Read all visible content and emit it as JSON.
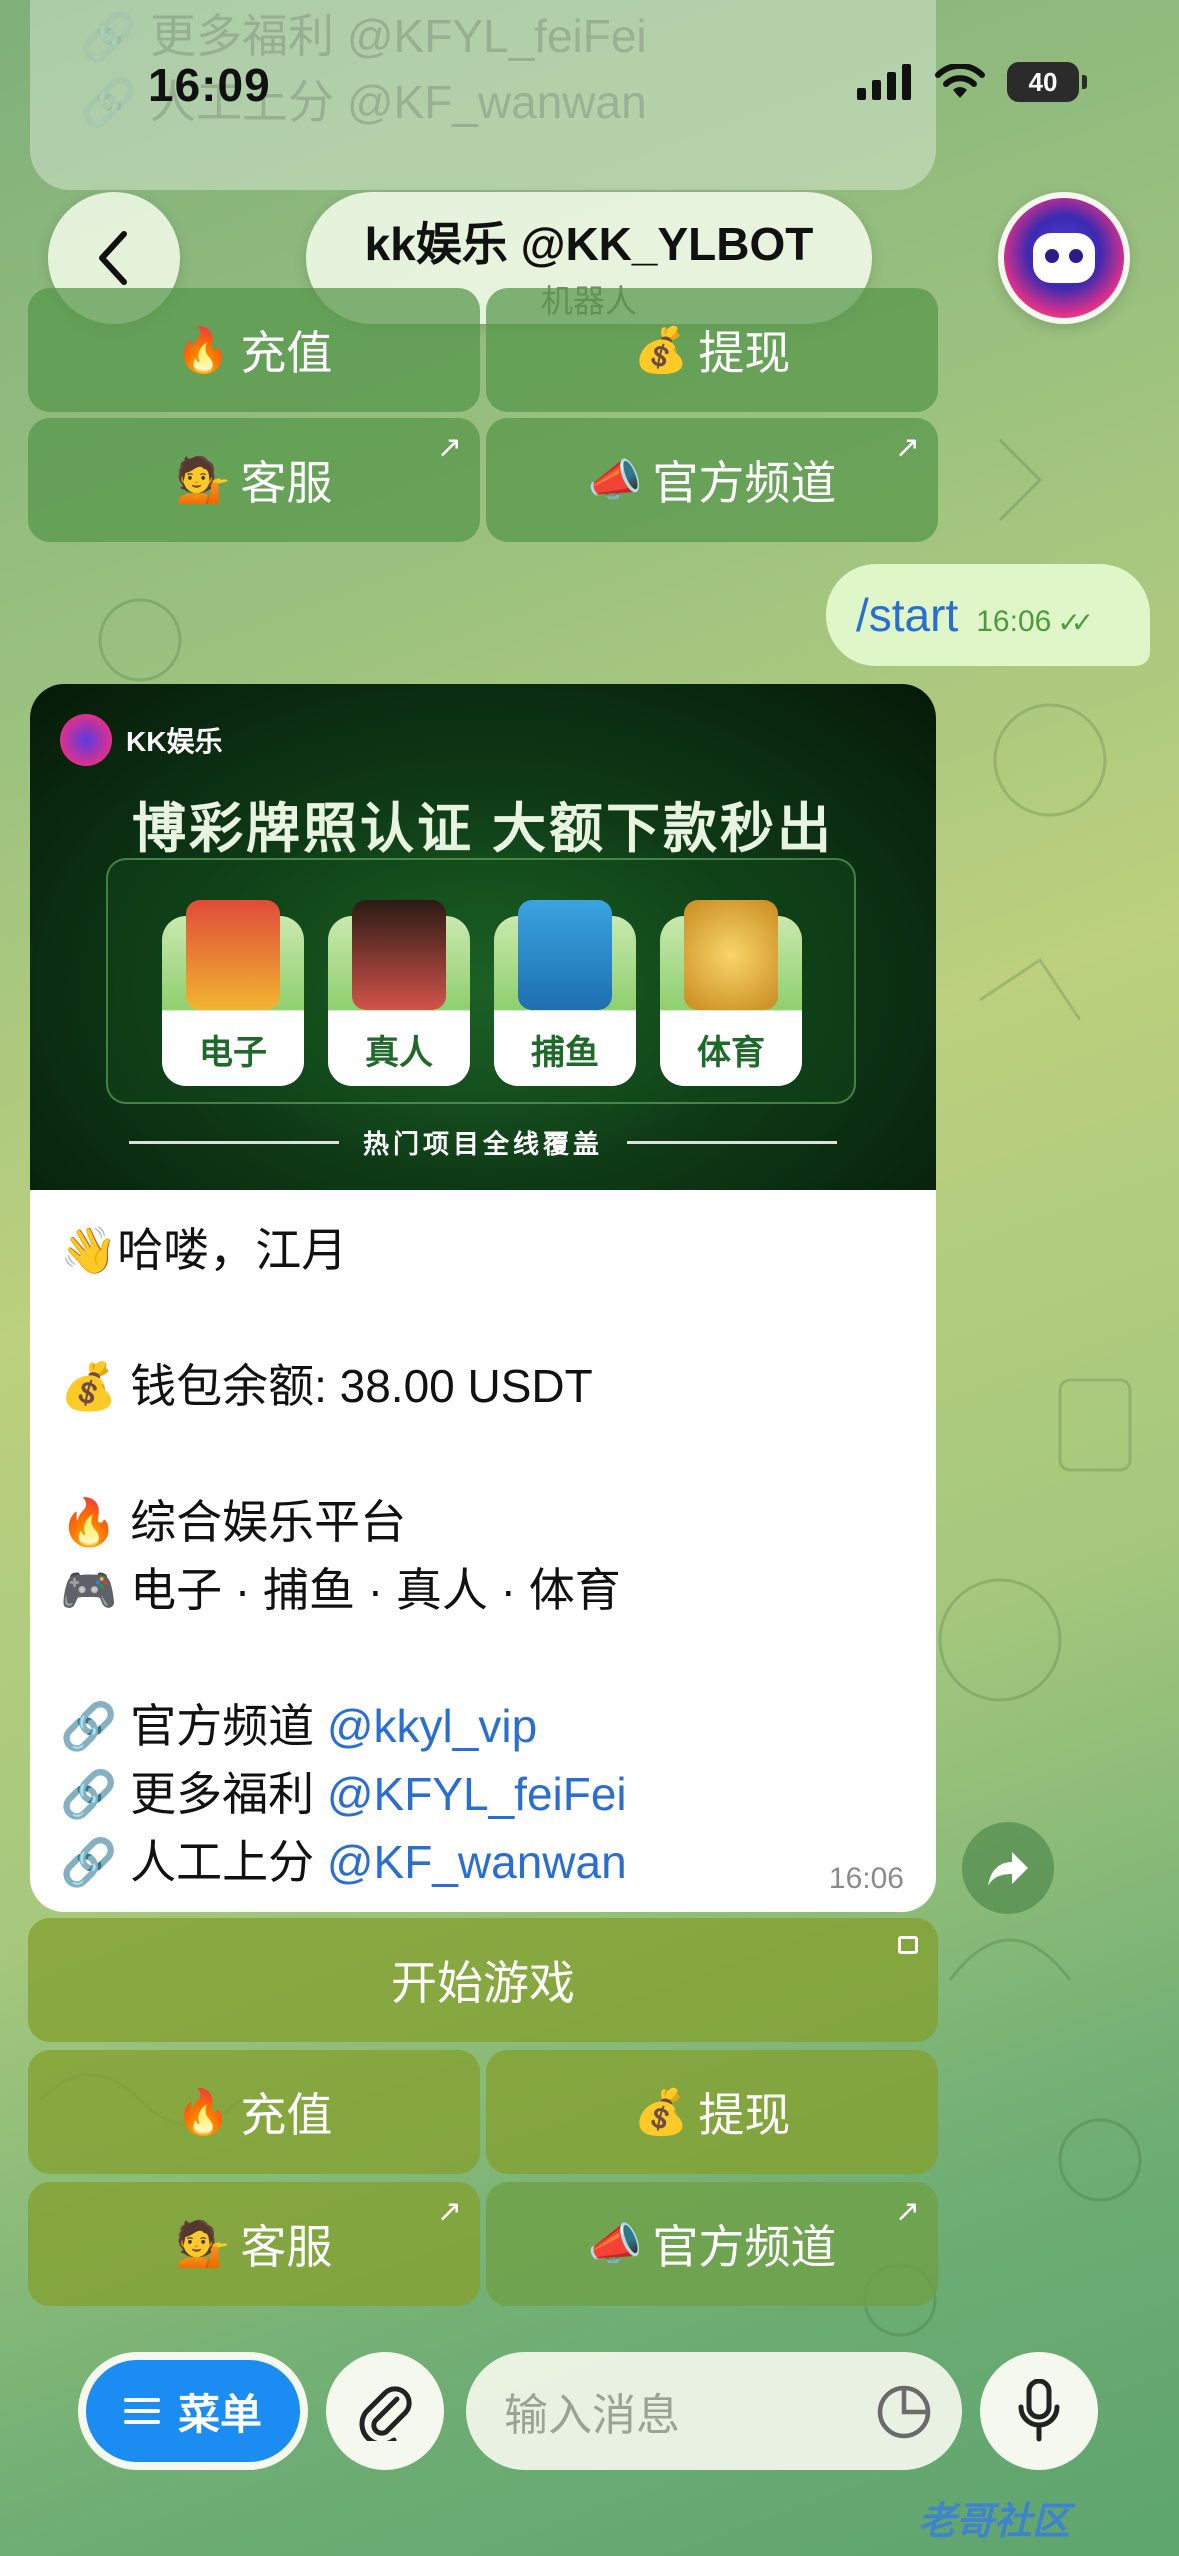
{
  "status": {
    "time": "16:09",
    "battery": "40"
  },
  "old_messages": [
    "🔗 更多福利 @KFYL_feiFei",
    "🔗 人工上分 @KF_wanwan"
  ],
  "header": {
    "title": "kk娱乐 @KK_YLBOT",
    "subtitle": "机器人"
  },
  "top_keyboard": {
    "recharge": "充值",
    "withdraw": "提现",
    "support": "客服",
    "channel": "官方频道"
  },
  "outgoing": {
    "text": "/start",
    "time": "16:06"
  },
  "banner": {
    "logo": "KK娱乐",
    "title": "博彩牌照认证   大额下款秒出",
    "tiles": [
      "电子",
      "真人",
      "捕鱼",
      "体育"
    ],
    "footer": "热门项目全线覆盖"
  },
  "message": {
    "greeting": "哈喽，江月",
    "balance": "钱包余额: 38.00 USDT",
    "platform": "综合娱乐平台",
    "games": "电子 · 捕鱼 · 真人 · 体育",
    "channel_label": "官方频道 ",
    "channel_link": "@kkyl_vip",
    "bonus_label": "更多福利 ",
    "bonus_link": "@KFYL_feiFei",
    "manual_label": "人工上分 ",
    "manual_link": "@KF_wanwan",
    "time": "16:06"
  },
  "keyboard": {
    "start_game": "开始游戏",
    "recharge": "充值",
    "withdraw": "提现",
    "support": "客服",
    "channel": "官方频道"
  },
  "input": {
    "menu": "菜单",
    "placeholder": "输入消息"
  },
  "watermark": "老哥社区"
}
